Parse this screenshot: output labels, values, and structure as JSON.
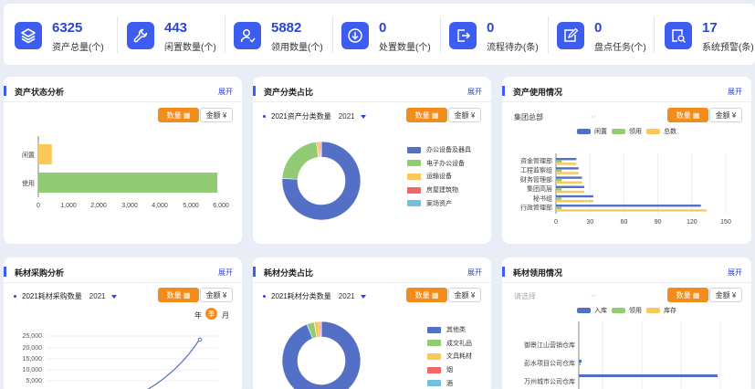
{
  "stats": [
    {
      "icon": "layers-icon",
      "value": "6325",
      "label": "资产总量(个)"
    },
    {
      "icon": "wrench-icon",
      "value": "443",
      "label": "闲置数量(个)"
    },
    {
      "icon": "user-receive-icon",
      "value": "5882",
      "label": "领用数量(个)"
    },
    {
      "icon": "download-circle-icon",
      "value": "0",
      "label": "处置数量(个)"
    },
    {
      "icon": "exit-icon",
      "value": "0",
      "label": "流程待办(条)"
    },
    {
      "icon": "edit-doc-icon",
      "value": "0",
      "label": "盘点任务(个)"
    },
    {
      "icon": "search-doc-icon",
      "value": "17",
      "label": "系统预警(条)"
    }
  ],
  "buttons": {
    "qty": "数量",
    "amt": "金额 ¥"
  },
  "expand": "展开",
  "cards": {
    "status": {
      "title": "资产状态分析"
    },
    "category": {
      "title": "资产分类占比",
      "selector": "2021资产分类数量",
      "year": "2021"
    },
    "usage": {
      "title": "资产使用情况",
      "dept": "集团总部"
    },
    "purchase": {
      "title": "耗材采购分析",
      "selector": "2021耗材采购数量",
      "year": "2021",
      "toggle": {
        "year": "年",
        "season": "季",
        "month": "月"
      }
    },
    "material": {
      "title": "耗材分类占比",
      "selector": "2021耗材分类数量",
      "year": "2021"
    },
    "receive": {
      "title": "耗材领用情况",
      "placeholder": "请选择"
    }
  },
  "colors": {
    "blue": "#5470c6",
    "green": "#91cc75",
    "yellow": "#fac858",
    "red": "#ee6666",
    "cyan": "#73c0de",
    "orange": "#f28c1c",
    "accent": "#3d5df0"
  },
  "chart_data": [
    {
      "type": "bar",
      "orientation": "horizontal",
      "categories": [
        "闲置",
        "使用"
      ],
      "values": [
        443,
        5882
      ],
      "xlim": [
        0,
        6000
      ],
      "xticks": [
        "0",
        "1,000",
        "2,000",
        "3,000",
        "4,000",
        "5,000",
        "6,000"
      ]
    },
    {
      "type": "pie",
      "subtype": "donut",
      "slices": [
        {
          "name": "办公设备及器具",
          "value": 76
        },
        {
          "name": "电子办公设备",
          "value": 22
        },
        {
          "name": "运输设备",
          "value": 1
        },
        {
          "name": "房屋建筑物",
          "value": 0.6
        },
        {
          "name": "案场资产",
          "value": 0.4
        }
      ]
    },
    {
      "type": "bar",
      "orientation": "horizontal",
      "categories": [
        "资金管理部",
        "工程监察组",
        "财务管理部",
        "集团高层",
        "秘书组",
        "行政管理部"
      ],
      "series": [
        {
          "name": "闲置",
          "values": [
            18,
            20,
            23,
            25,
            33,
            128
          ]
        },
        {
          "name": "领用",
          "values": [
            5,
            5,
            5,
            5,
            5,
            5
          ]
        },
        {
          "name": "总数",
          "values": [
            18,
            20,
            23,
            25,
            33,
            133
          ]
        }
      ],
      "xlim": [
        0,
        150
      ],
      "xticks": [
        "0",
        "30",
        "60",
        "90",
        "120",
        "150"
      ]
    },
    {
      "type": "line",
      "yticks": [
        "25,000",
        "20,000",
        "15,000",
        "10,000",
        "5,000"
      ],
      "values": [
        0,
        0,
        0,
        300,
        1800,
        6500,
        23000
      ]
    },
    {
      "type": "pie",
      "subtype": "donut",
      "slices": [
        {
          "name": "其他类",
          "value": 94
        },
        {
          "name": "成交礼品",
          "value": 3
        },
        {
          "name": "文具耗材",
          "value": 2
        },
        {
          "name": "烟",
          "value": 0.6
        },
        {
          "name": "酒",
          "value": 0.4
        }
      ]
    },
    {
      "type": "bar",
      "orientation": "horizontal",
      "categories": [
        "御景江山营销仓库",
        "彭水项目公司仓库",
        "万州城市公司仓库"
      ],
      "series": [
        {
          "name": "入库",
          "values": [
            0,
            2,
            100
          ]
        },
        {
          "name": "领用",
          "values": [
            0,
            0.5,
            0
          ]
        },
        {
          "name": "库存",
          "values": [
            0,
            0,
            0
          ]
        }
      ]
    }
  ]
}
